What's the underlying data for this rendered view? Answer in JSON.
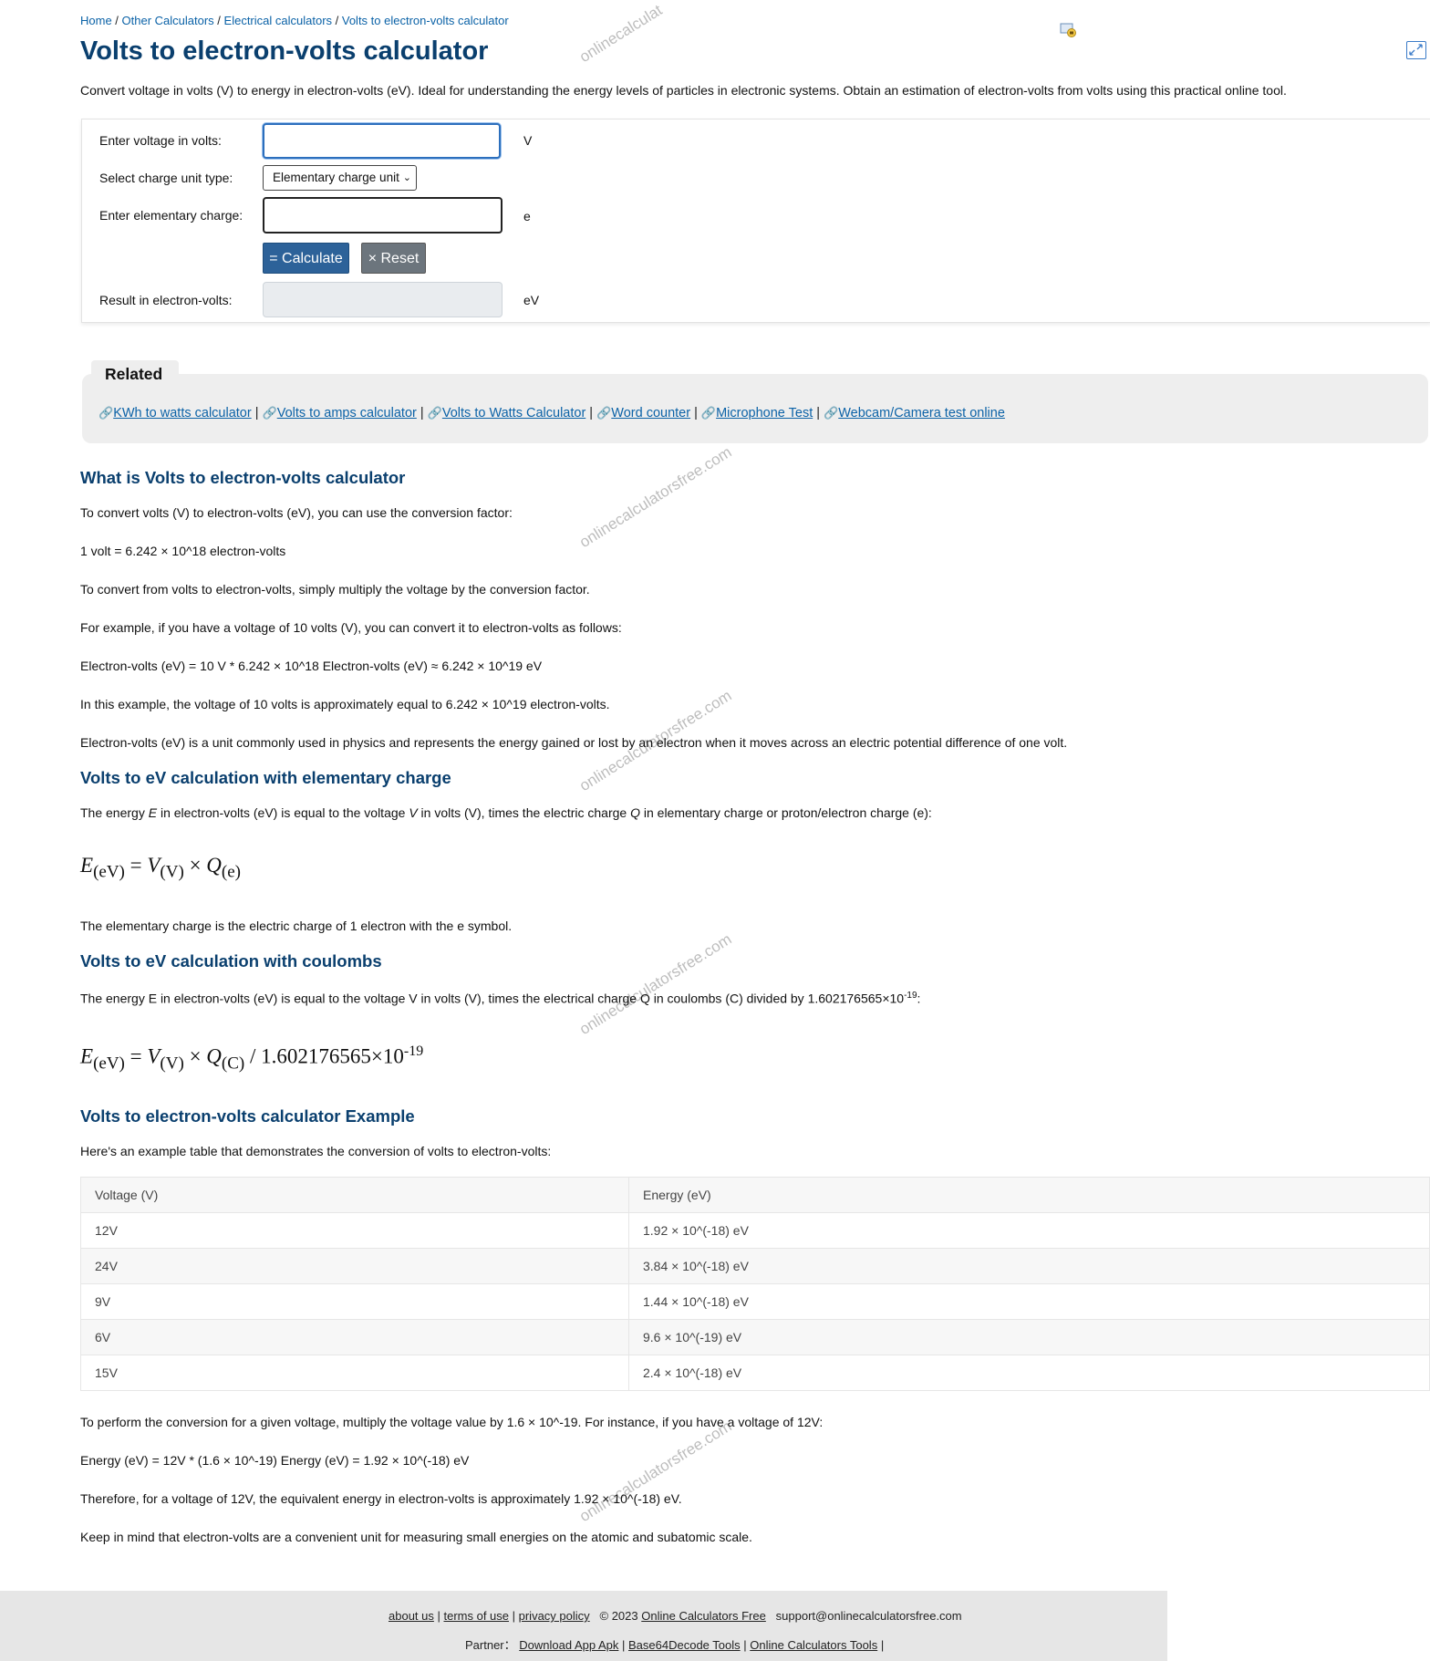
{
  "breadcrumb": {
    "home": "Home",
    "sep": " / ",
    "other": "Other Calculators",
    "electrical": "Electrical calculators",
    "current": "Volts to electron-volts calculator"
  },
  "page_title": "Volts to electron-volts calculator",
  "intro": "Convert voltage in volts (V) to energy in electron-volts (eV). Ideal for understanding the energy levels of particles in electronic systems. Obtain an estimation of electron-volts from volts using this practical online tool.",
  "calculator": {
    "voltage_label": "Enter voltage in volts:",
    "voltage_value": "",
    "voltage_unit": "V",
    "charge_type_label": "Select charge unit type:",
    "charge_type_selected": "Elementary charge unit",
    "charge_label": "Enter elementary charge:",
    "charge_value": "",
    "charge_unit": "e",
    "calculate_button": "= Calculate",
    "reset_button": "× Reset",
    "result_label": "Result in electron-volts:",
    "result_value": "",
    "result_unit": "eV"
  },
  "related": {
    "title": "Related",
    "links": [
      "KWh to watts calculator",
      "Volts to amps calculator",
      "Volts to Watts Calculator",
      "Word counter",
      "Microphone Test",
      "Webcam/Camera test online"
    ],
    "separator": " | "
  },
  "sections": {
    "what_is": {
      "heading": "What is Volts to electron-volts calculator",
      "p1": "To convert volts (V) to electron-volts (eV), you can use the conversion factor:",
      "p2": "1 volt = 6.242 × 10^18 electron-volts",
      "p3": "To convert from volts to electron-volts, simply multiply the voltage by the conversion factor.",
      "p4": "For example, if you have a voltage of 10 volts (V), you can convert it to electron-volts as follows:",
      "p5": "Electron-volts (eV) = 10 V * 6.242 × 10^18 Electron-volts (eV) ≈ 6.242 × 10^19 eV",
      "p6": "In this example, the voltage of 10 volts is approximately equal to 6.242 × 10^19 electron-volts.",
      "p7": "Electron-volts (eV) is a unit commonly used in physics and represents the energy gained or lost by an electron when it moves across an electric potential difference of one volt."
    },
    "elementary": {
      "heading": "Volts to eV calculation with elementary charge",
      "p1_a": "The energy ",
      "p1_e": "E",
      "p1_b": " in electron-volts (eV) is equal to the voltage ",
      "p1_v": "V",
      "p1_c": " in volts (V), times the electric charge ",
      "p1_q": "Q",
      "p1_d": " in elementary charge or proton/electron charge (e):",
      "f_e": "E",
      "f_sub_e": "(eV)",
      "f_eq": " = ",
      "f_v": "V",
      "f_sub_v": "(V)",
      "f_times": " × ",
      "f_q": "Q",
      "f_sub_q": "(e)",
      "p2": "The elementary charge is the electric charge of 1 electron with the e symbol."
    },
    "coulombs": {
      "heading": "Volts to eV calculation with coulombs",
      "p1": "The energy E in electron-volts (eV) is equal to the voltage V in volts (V), times the electrical charge Q in coulombs (C) divided by 1.602176565×10",
      "p1_sup": "-19",
      "p1_end": ":",
      "f_e": "E",
      "f_sub_e": "(eV)",
      "f_eq": " = ",
      "f_v": "V",
      "f_sub_v": "(V)",
      "f_times": " × ",
      "f_q": "Q",
      "f_sub_q": "(C)",
      "f_div": " / 1.602176565×10",
      "f_sup": "-19"
    },
    "example": {
      "heading": "Volts to electron-volts calculator Example",
      "intro": "Here's an example table that demonstrates the conversion of volts to electron-volts:",
      "table_headers": [
        "Voltage (V)",
        "Energy (eV)"
      ],
      "table_rows": [
        [
          "12V",
          "1.92 × 10^(-18) eV"
        ],
        [
          "24V",
          "3.84 × 10^(-18) eV"
        ],
        [
          "9V",
          "1.44 × 10^(-18) eV"
        ],
        [
          "6V",
          "9.6 × 10^(-19) eV"
        ],
        [
          "15V",
          "2.4 × 10^(-18) eV"
        ]
      ],
      "p1": "To perform the conversion for a given voltage, multiply the voltage value by 1.6 × 10^-19. For instance, if you have a voltage of 12V:",
      "p2": "Energy (eV) = 12V * (1.6 × 10^-19) Energy (eV) = 1.92 × 10^(-18) eV",
      "p3": "Therefore, for a voltage of 12V, the equivalent energy in electron-volts is approximately 1.92 × 10^(-18) eV.",
      "p4": "Keep in mind that electron-volts are a convenient unit for measuring small energies on the atomic and subatomic scale."
    }
  },
  "watermark": "onlinecalculatorsfree.com",
  "watermark_partial_top": "onlinecalculat",
  "footer": {
    "about": "about us",
    "terms": "terms of use",
    "privacy": "privacy policy",
    "copyright": "© 2023",
    "brand": "Online Calculators Free",
    "email": "support@onlinecalculatorsfree.com",
    "partner_label": "Partner：",
    "partner_links": [
      "Download App Apk",
      "Base64Decode Tools",
      "Online Calculators Tools"
    ],
    "sep": " | "
  },
  "icons": {
    "tool": "tool-icon",
    "expand": "expand-icon",
    "link": "link-icon"
  },
  "colors": {
    "heading": "#0a3f6e",
    "link": "#0b62a7",
    "calculate_button": "#2d6299",
    "reset_button": "#6c757d"
  }
}
